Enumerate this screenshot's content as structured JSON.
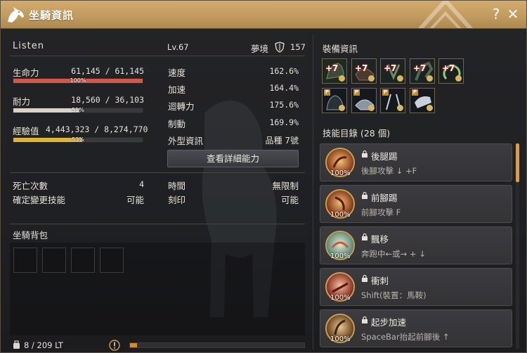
{
  "window": {
    "title": "坐騎資訊",
    "help_glyph": "?",
    "close_glyph": "✕"
  },
  "mount": {
    "name": "Listen",
    "level": "Lv.67",
    "realm_label": "夢境",
    "realm_value": "157"
  },
  "bars": {
    "hp": {
      "label": "生命力",
      "value": "61,145 / 61,145",
      "pct_label": "100%",
      "fraction": 1.0,
      "color": "#d2584c"
    },
    "stamina": {
      "label": "耐力",
      "value": "18,560 / 36,103",
      "pct_label": "51%",
      "fraction": 0.51,
      "color": "#d8d3c6"
    },
    "exp": {
      "label": "經驗值",
      "value": "4,443,323 / 8,274,770",
      "pct_label": "53%",
      "fraction": 0.53,
      "color": "#e0b43c"
    }
  },
  "stats": [
    {
      "label": "速度",
      "value": "162.6%"
    },
    {
      "label": "加速",
      "value": "164.4%"
    },
    {
      "label": "迴轉力",
      "value": "175.6%"
    },
    {
      "label": "制動",
      "value": "169.9%"
    },
    {
      "label": "外型資訊",
      "value": "品種 7號"
    }
  ],
  "detail_button": "查看詳細能力",
  "misc": {
    "deaths_label": "死亡次數",
    "deaths_value": "4",
    "time_label": "時間",
    "time_value": "無限制",
    "change_skill_label": "確定變更技能",
    "change_skill_value": "可能",
    "imprint_label": "刻印",
    "imprint_value": "可能"
  },
  "inventory": {
    "title": "坐騎背包",
    "weight": "8 / 209 LT",
    "weight_fraction": 0.04,
    "slot_count": 4
  },
  "equipment": {
    "title": "裝備資訊",
    "row1": [
      {
        "enhance": "+7",
        "icon": "barding-armor-icon"
      },
      {
        "enhance": "+7",
        "icon": "saddle-icon"
      },
      {
        "enhance": "+7",
        "icon": "stirrups-icon"
      },
      {
        "enhance": "+7",
        "icon": "horseshoe-icon"
      },
      {
        "enhance": "+7",
        "icon": "horseshoe-ring-icon"
      }
    ],
    "row2": [
      {
        "tag": "P",
        "icon": "costume-armor-icon"
      },
      {
        "tag": "P",
        "icon": "costume-saddle-icon"
      },
      {
        "tag": "P",
        "icon": "costume-stirrups-icon"
      },
      {
        "tag": "P",
        "icon": "costume-head-icon"
      }
    ]
  },
  "skills": {
    "title": "技能目錄 (28 個)",
    "items": [
      {
        "name": "後腿踢",
        "key": "後腳攻擊 ↓ +F",
        "pct": "100%",
        "color": "#c4622e"
      },
      {
        "name": "前腳踢",
        "key": "前腳攻擊 F",
        "pct": "100%",
        "color": "#b8582c"
      },
      {
        "name": "飄移",
        "key": "奔跑中←或→ + ↓",
        "pct": "100%",
        "color": "#8fb2a4"
      },
      {
        "name": "衝刺",
        "key": "Shift(裝置：馬鞍)",
        "pct": "100%",
        "color": "#c25a3a"
      },
      {
        "name": "起步加速",
        "key": "SpaceBar抬起前腳後 ↑",
        "pct": "100%",
        "color": "#a46a32"
      }
    ]
  },
  "colors": {
    "accent": "#c9a561",
    "panel": "#222226"
  }
}
